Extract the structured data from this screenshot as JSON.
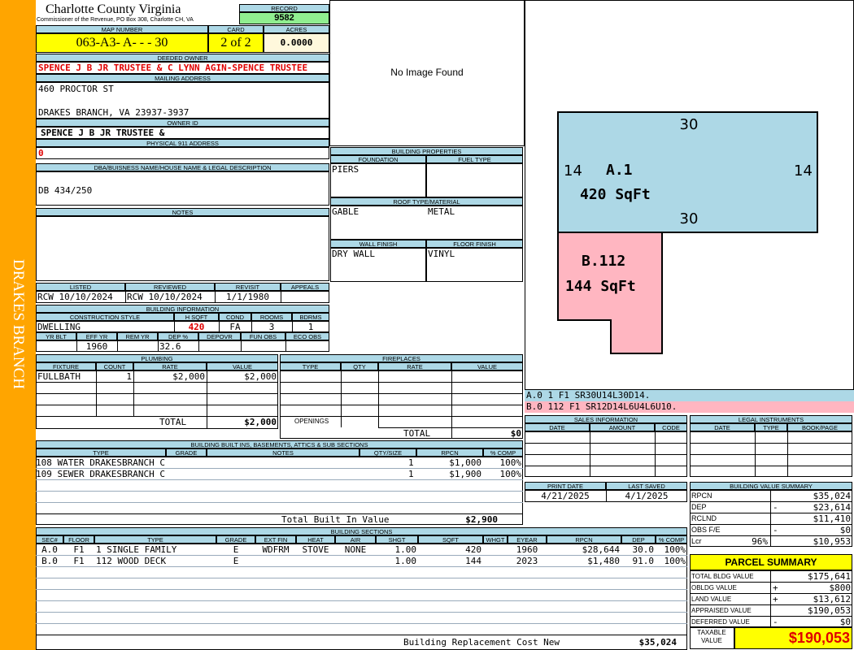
{
  "sidebar": {
    "label": "DRAKES BRANCH"
  },
  "header": {
    "county": "Charlotte County Virginia",
    "address": "Commissioner of the Revenue, PO Box 308, Charlotte CH, VA",
    "record_label": "RECORD",
    "record": "9582",
    "map_label": "MAP NUMBER",
    "map": "063-A3- A-  -  - 30",
    "card_label": "CARD",
    "card": "2 of 2",
    "acres_label": "ACRES",
    "acres": "0.0000"
  },
  "owner": {
    "deeded_label": "DEEDED OWNER",
    "deeded": "SPENCE J B JR TRUSTEE & C LYNN AGIN-SPENCE TRUSTEE",
    "mailing_label": "MAILING ADDRESS",
    "mail1": "460 PROCTOR ST",
    "mail2": "DRAKES BRANCH, VA 23937-3937",
    "owner_id_label": "OWNER ID",
    "owner_id": "SPENCE J B JR TRUSTEE &",
    "phys_label": "PHYSICAL 911 ADDRESS",
    "phys": "0",
    "dba_label": "DBA/BUISNESS NAME/HOUSE NAME & LEGAL DESCRIPTION",
    "dba": "DB 434/250",
    "notes_label": "NOTES"
  },
  "image": {
    "no_image": "No Image Found"
  },
  "building_props": {
    "title": "BUILDING PROPERTIES",
    "foundation_label": "FOUNDATION",
    "foundation": "PIERS",
    "fuel_label": "FUEL TYPE",
    "fuel": "",
    "roof_label": "ROOF TYPE/MATERIAL",
    "roof_type": "GABLE",
    "roof_material": "METAL",
    "wall_label": "WALL FINISH",
    "wall": "DRY WALL",
    "floor_label": "FLOOR FINISH",
    "floor": "VINYL"
  },
  "sketch": {
    "a_top": "30",
    "a_left": "14",
    "a_right": "14",
    "a_bottom": "30",
    "a_name": "A.1",
    "a_area": "420 SqFt",
    "b_name": "B.112",
    "b_area": "144 SqFt",
    "a_color": "#add8e6",
    "b_color": "#ffb6c1",
    "line_a": "A.0   1   F1  SR30U14L30D14.",
    "line_b": "B.0  112  F1  SR12D14L6U4L6U10."
  },
  "review": {
    "listed_label": "LISTED",
    "listed": "RCW 10/10/2024",
    "reviewed_label": "REVIEWED",
    "reviewed": "RCW 10/10/2024",
    "revisit_label": "REVISIT",
    "revisit": "1/1/1980",
    "appeals_label": "APPEALS",
    "appeals": ""
  },
  "building_info": {
    "title": "BUILDING INFORMATION",
    "cs_label": "CONSTRUCTION STYLE",
    "cs": "DWELLING",
    "hsqft_label": "H SQFT",
    "hsqft": "420",
    "cond_label": "COND",
    "cond": "FA",
    "rooms_label": "ROOMS",
    "rooms": "3",
    "bdrms_label": "BDRMS",
    "bdrms": "1",
    "yrblt_label": "YR BLT",
    "yrblt": "",
    "effyr_label": "EFF YR",
    "effyr": "1960",
    "remyr_label": "REM YR",
    "remyr": "",
    "dep_label": "DEP %",
    "dep": "32.6",
    "depovr_label": "DEPOVR",
    "funobs_label": "FUN OBS",
    "ecoobs_label": "ECO OBS"
  },
  "plumbing": {
    "title": "PLUMBING",
    "fixture_label": "FIXTURE",
    "count_label": "COUNT",
    "rate_label": "RATE",
    "value_label": "VALUE",
    "fixture": "FULLBATH",
    "count": "1",
    "rate": "$2,000",
    "value": "$2,000",
    "total_label": "TOTAL",
    "total": "$2,000"
  },
  "fireplaces": {
    "title": "FIREPLACES",
    "type_label": "TYPE",
    "qty_label": "QTY",
    "rate_label": "RATE",
    "value_label": "VALUE",
    "openings_label": "OPENINGS",
    "total_label": "TOTAL",
    "total": "$0"
  },
  "sales": {
    "title": "SALES INFORMATION",
    "date_label": "DATE",
    "amount_label": "AMOUNT",
    "code_label": "CODE"
  },
  "legal": {
    "title": "LEGAL INSTRUMENTS",
    "date_label": "DATE",
    "type_label": "TYPE",
    "book_label": "BOOK/PAGE"
  },
  "builtins": {
    "title": "BUILDING BUILT INS, BASEMENTS, ATTICS & SUB SECTIONS",
    "type_label": "TYPE",
    "grade_label": "GRADE",
    "notes_label": "NOTES",
    "qty_label": "QTY/SIZE",
    "rpcn_label": "RPCN",
    "comp_label": "% COMP",
    "rows": [
      {
        "type": "108 WATER DRAKESBRANCH C",
        "qty": "1",
        "rpcn": "$1,000",
        "comp": "100%"
      },
      {
        "type": "109 SEWER DRAKESBRANCH C",
        "qty": "1",
        "rpcn": "$1,900",
        "comp": "100%"
      }
    ],
    "total_label": "Total Built In Value",
    "total": "$2,900"
  },
  "print": {
    "print_label": "PRINT DATE",
    "print_date": "4/21/2025",
    "saved_label": "LAST SAVED",
    "saved": "4/1/2025"
  },
  "value_summary": {
    "title": "BUILDING VALUE SUMMARY",
    "rows": [
      {
        "label": "RPCN",
        "sign": "",
        "value": "$35,024"
      },
      {
        "label": "DEP",
        "sign": "-",
        "value": "$23,614"
      },
      {
        "label": "RCLND",
        "sign": "",
        "value": "$11,410"
      },
      {
        "label": "OBS F/E",
        "sign": "-",
        "value": "$0"
      },
      {
        "label": "Lcr",
        "sign": "96%",
        "value": "$10,953"
      }
    ]
  },
  "sections": {
    "title": "BUILDING SECTIONS",
    "headers": [
      "SEC#",
      "FLOOR",
      "TYPE",
      "GRADE",
      "EXT FIN",
      "HEAT",
      "AIR",
      "SHGT",
      "SQFT",
      "WHGT",
      "EYEAR",
      "RPCN",
      "DEP",
      "% COMP"
    ],
    "rows": [
      [
        "A.0",
        "F1",
        "1 SINGLE FAMILY",
        "E",
        "WDFRM",
        "STOVE",
        "NONE",
        "1.00",
        "420",
        "",
        "1960",
        "$28,644",
        "30.0",
        "100%"
      ],
      [
        "B.0",
        "F1",
        "112 WOOD DECK",
        "E",
        "",
        "",
        "",
        "1.00",
        "144",
        "",
        "2023",
        "$1,480",
        "91.0",
        "100%"
      ]
    ],
    "total_label": "Building Replacement Cost New",
    "total": "$35,024"
  },
  "parcel": {
    "title": "PARCEL SUMMARY",
    "rows": [
      {
        "label": "TOTAL BLDG VALUE",
        "sign": "",
        "value": "$175,641"
      },
      {
        "label": "OBLDG VALUE",
        "sign": "+",
        "value": "$800"
      },
      {
        "label": "LAND VALUE",
        "sign": "+",
        "value": "$13,612"
      },
      {
        "label": "APPRAISED VALUE",
        "sign": "",
        "value": "$190,053"
      },
      {
        "label": "DEFERRED VALUE",
        "sign": "-",
        "value": "$0"
      }
    ],
    "taxable_label": "TAXABLE VALUE",
    "taxable": "$190,053"
  }
}
